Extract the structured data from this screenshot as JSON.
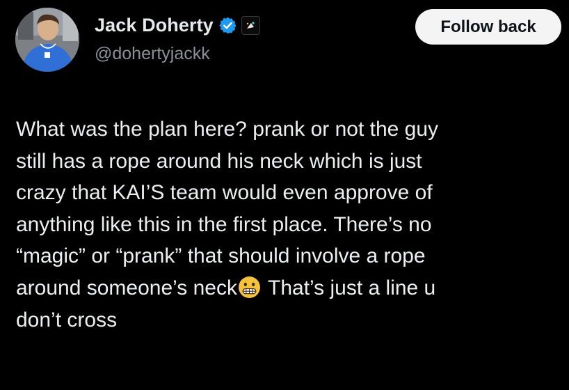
{
  "author": {
    "display_name": "Jack Doherty",
    "handle": "@dohertyjackk",
    "verified_icon": "verified-badge-icon",
    "affiliate_icon": "affiliate-badge-icon"
  },
  "actions": {
    "follow_label": "Follow back"
  },
  "tweet": {
    "lines": [
      "What was the plan here? prank or not the guy",
      "still has a rope around his neck which is just",
      "crazy that KAI’S team would even approve of",
      "anything like this in the first place. There’s no",
      "“magic” or “prank” that should involve a rope",
      "around someone’s neck",
      "That’s just a line u",
      "don’t cross"
    ],
    "emoji": "grimacing-face-emoji"
  },
  "colors": {
    "background": "#000000",
    "text_primary": "#e7e9ea",
    "text_secondary": "#8b9096",
    "verified_blue": "#1d9bf0",
    "button_bg": "#f4f4f4",
    "button_text": "#0f1419"
  }
}
